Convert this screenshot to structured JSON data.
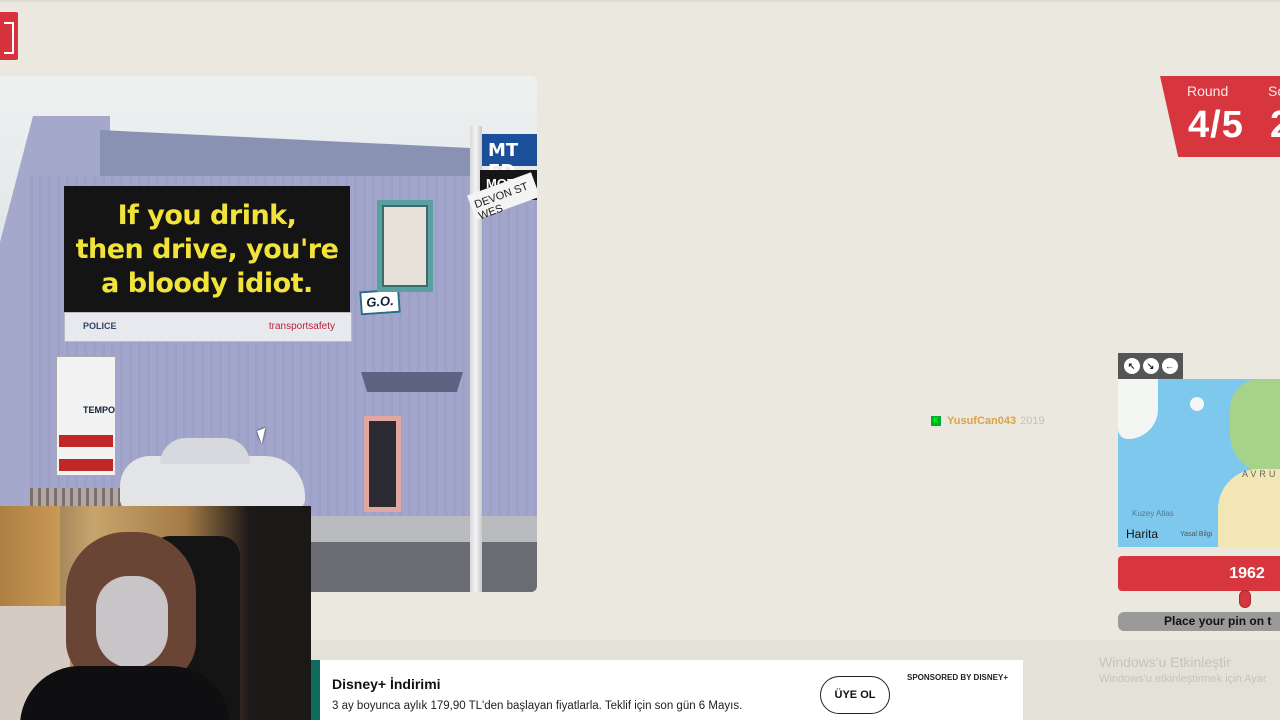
{
  "app": {
    "logo_icon": "app-logo-icon",
    "accent_color": "#d8363f"
  },
  "photo": {
    "billboard_text": "If you drink, then drive, you're a bloody idiot.",
    "billboard_sponsor": "transportsafety",
    "billboard_police": "POLICE",
    "badge_text": "G.O.",
    "street_sign_1": "MT ED",
    "street_sign_2": "MOTE",
    "street_sign_3": "DEVON ST WES",
    "shop_sign": "TEMPO"
  },
  "round": {
    "round_label": "Round",
    "round_value": "4/5",
    "score_label": "Sc",
    "score_value": "2"
  },
  "player": {
    "badge": "K",
    "name": "YusufCan043",
    "year": "2019"
  },
  "map": {
    "label_region": "AVRU",
    "sea_label": "Kuzey Atlas",
    "brand": "Harita",
    "legal": "Yasal Bilgi",
    "tools": [
      "expand-icon",
      "shrink-icon",
      "pin-left-icon"
    ]
  },
  "guess": {
    "year": "1962",
    "slider_fraction": 0.78,
    "place_pin_text": "Place your pin on t"
  },
  "ad": {
    "title": "Disney+ İndirimi",
    "text": "3 ay boyunca aylık 179,90 TL'den başlayan fiyatlarla. Teklif için son gün 6 Mayıs.",
    "button": "ÜYE OL",
    "sponsor": "SPONSORED BY DISNEY+"
  },
  "os_watermark": {
    "line1": "Windows'u Etkinleştir",
    "line2": "Windows'u etkinleştirmek için Ayar"
  }
}
